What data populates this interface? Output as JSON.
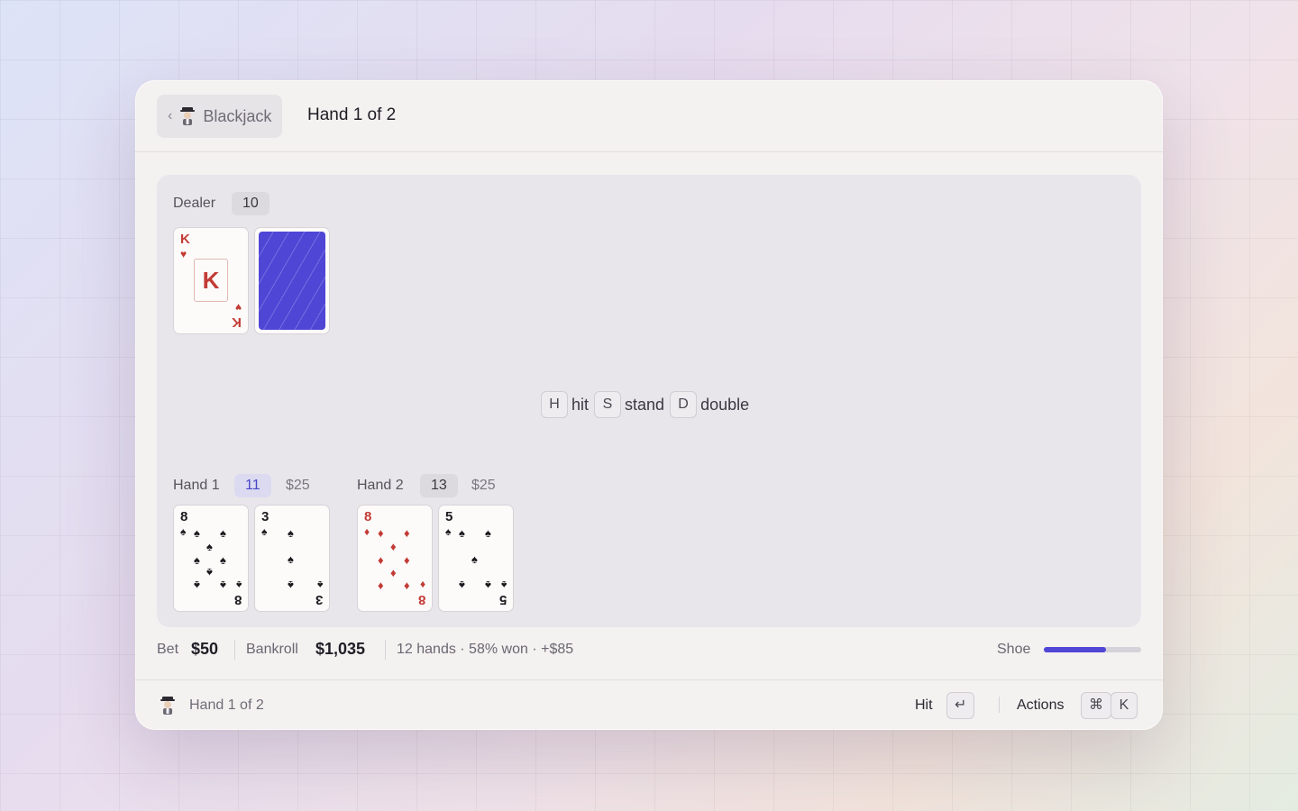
{
  "header": {
    "back_label": "Blackjack",
    "title": "Hand 1 of 2"
  },
  "dealer": {
    "label": "Dealer",
    "total": "10",
    "cards": [
      {
        "rank": "K",
        "suit": "♥",
        "color": "red",
        "face_up": true
      },
      {
        "face_up": false
      }
    ]
  },
  "hints": [
    {
      "key": "H",
      "action": "hit"
    },
    {
      "key": "S",
      "action": "stand"
    },
    {
      "key": "D",
      "action": "double"
    }
  ],
  "hands": [
    {
      "label": "Hand 1",
      "total": "11",
      "bet": "$25",
      "active": true,
      "cards": [
        {
          "rank": "8",
          "suit": "♠",
          "color": "black"
        },
        {
          "rank": "3",
          "suit": "♠",
          "color": "black"
        }
      ]
    },
    {
      "label": "Hand 2",
      "total": "13",
      "bet": "$25",
      "active": false,
      "cards": [
        {
          "rank": "8",
          "suit": "♦",
          "color": "red"
        },
        {
          "rank": "5",
          "suit": "♠",
          "color": "black"
        }
      ]
    }
  ],
  "stats": {
    "bet_label": "Bet",
    "bet_value": "$50",
    "bankroll_label": "Bankroll",
    "bankroll_value": "$1,035",
    "summary": "12 hands · 58% won · +$85",
    "shoe_label": "Shoe",
    "shoe_fraction": 0.64
  },
  "footer": {
    "title": "Hand 1 of 2",
    "primary_action": "Hit",
    "primary_key": "↵",
    "actions_label": "Actions",
    "actions_keys": [
      "⌘",
      "K"
    ]
  },
  "colors": {
    "accent": "#4f46d6",
    "red_suit": "#c33b35",
    "black_suit": "#1b1a1f"
  },
  "icons": {
    "app": "blackjack-dealer-icon",
    "back": "chevron-left-icon"
  }
}
